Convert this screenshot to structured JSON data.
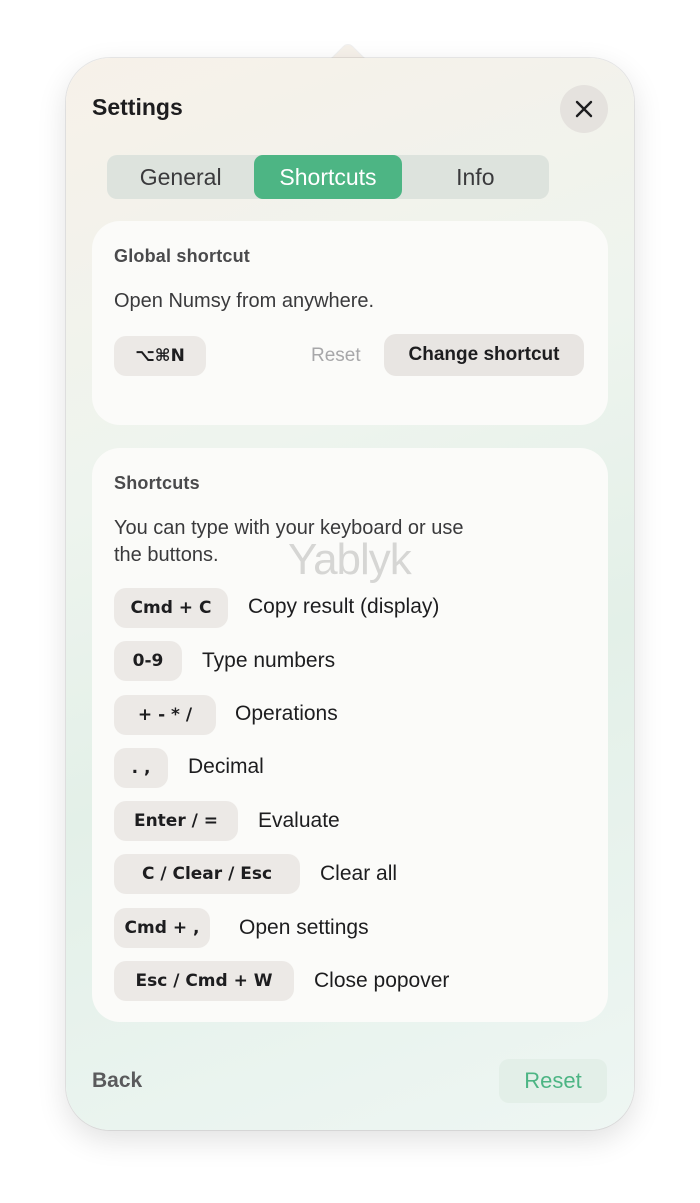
{
  "window": {
    "title": "Settings"
  },
  "tabs": [
    {
      "label": "General",
      "active": false
    },
    {
      "label": "Shortcuts",
      "active": true
    },
    {
      "label": "Info",
      "active": false
    }
  ],
  "global_shortcut": {
    "heading": "Global shortcut",
    "description": "Open Numsy from anywhere.",
    "current_key": "⌥⌘N",
    "reset_label": "Reset",
    "change_label": "Change shortcut"
  },
  "shortcuts": {
    "heading": "Shortcuts",
    "description_line1": "You can type with your keyboard or use",
    "description_line2": "the buttons.",
    "items": [
      {
        "key": "Cmd + C",
        "description": "Copy result (display)"
      },
      {
        "key": "0-9",
        "description": "Type numbers"
      },
      {
        "key": "+ - * /",
        "description": "Operations"
      },
      {
        "key": ". ,",
        "description": "Decimal"
      },
      {
        "key": "Enter / =",
        "description": "Evaluate"
      },
      {
        "key": "C / Clear / Esc",
        "description": "Clear all"
      },
      {
        "key": "Cmd + ,",
        "description": "Open settings"
      },
      {
        "key": "Esc / Cmd + W",
        "description": "Close popover"
      }
    ]
  },
  "footer": {
    "back_label": "Back",
    "reset_label": "Reset"
  },
  "watermark": "Yablyk",
  "icons": {
    "close": "close-icon"
  },
  "colors": {
    "accent": "#4db584"
  }
}
